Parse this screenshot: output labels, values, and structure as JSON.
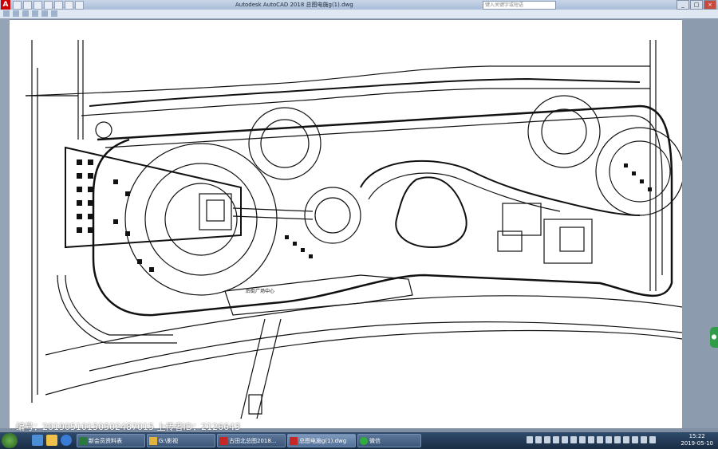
{
  "window": {
    "title": "Autodesk AutoCAD 2018    总图电施g(1).dwg",
    "search_placeholder": "键入关键字或短语",
    "app_icon": "A",
    "controls": [
      "minimize-icon",
      "maximize-icon",
      "close-icon"
    ]
  },
  "drawing": {
    "labels": {
      "plaza": "后街广场中心"
    }
  },
  "watermark": {
    "text": "编号：20190510150502487015 上传者ID：2126643"
  },
  "taskbar": {
    "items": [
      {
        "label": "新会员资料表",
        "icon": "excel-icon",
        "color": "#2b7a3d"
      },
      {
        "label": "G:\\影视",
        "icon": "folder-icon",
        "color": "#e2b33c"
      },
      {
        "label": "古田北总图2018...",
        "icon": "autocad-icon",
        "color": "#c62828"
      },
      {
        "label": "总图电施g(1).dwg",
        "icon": "autocad-icon",
        "color": "#c62828"
      },
      {
        "label": "微信",
        "icon": "wechat-icon",
        "color": "#2fae3b"
      }
    ],
    "time": "15:22",
    "date": "2019-05-10"
  }
}
